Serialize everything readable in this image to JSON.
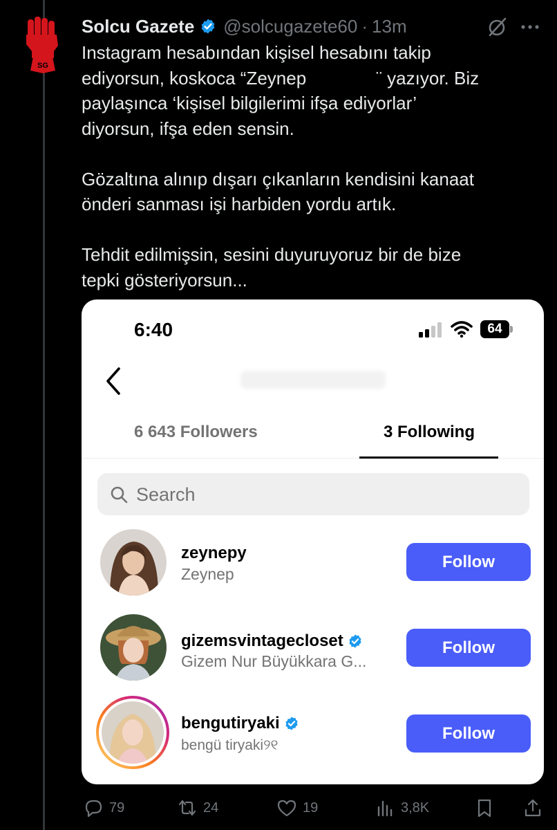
{
  "tweet": {
    "display_name": "Solcu Gazete",
    "handle": "@solcugazete60",
    "separator": "·",
    "time": "13m",
    "text": "Instagram hesabından kişisel hesabını takip\nediyorsun, koskoca “Zeynep              ¨ yazıyor. Biz\npaylaşınca ‘kişisel bilgilerimi ifşa ediyorlar’\ndiyorsun, ifşa eden sensin.\n\nGözaltına alınıp dışarı çıkanların kendisini kanaat\nönderi sanması işi harbiden yordu artık.\n\nTehdit edilmişsin, sesini duyuruyoruz bir de bize\ntepki gösteriyorsun...",
    "avatar_text": "SG",
    "icons": [
      "verified-badge-icon",
      "grok-icon",
      "more-icon"
    ]
  },
  "screenshot": {
    "status_time": "6:40",
    "battery": "64",
    "tabs": {
      "followers": "6 643 Followers",
      "following": "3 Following"
    },
    "search_placeholder": "Search",
    "accounts": [
      {
        "username": "zeynepy",
        "fullname": "Zeynep",
        "verified": false,
        "button": "Follow"
      },
      {
        "username": "gizemsvintagecloset",
        "fullname": "Gizem Nur Büyükkara G...",
        "verified": true,
        "button": "Follow"
      },
      {
        "username": "bengutiryaki",
        "fullname": "bengü tiryaki୨୧",
        "verified": true,
        "button": "Follow"
      }
    ]
  },
  "actions": {
    "replies": "79",
    "reposts": "24",
    "likes": "19",
    "views": "3,8K"
  },
  "colors": {
    "background": "#000000",
    "text": "#e7e9ea",
    "muted": "#71767b",
    "verified": "#1d9bf0",
    "follow_button": "#4a5df9",
    "logo_red": "#d4151c"
  }
}
